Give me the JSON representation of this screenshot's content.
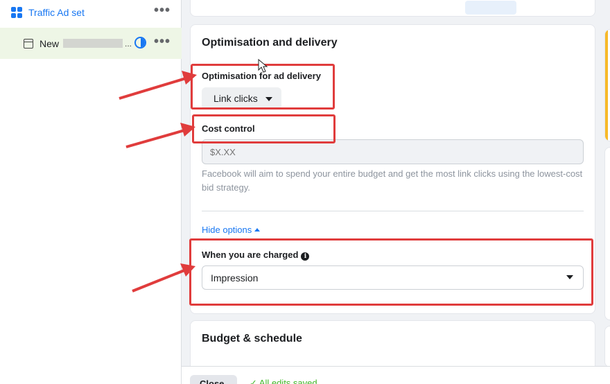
{
  "sidebar": {
    "adset_label": "Traffic Ad set",
    "ad_label": "New",
    "ad_suffix": "..."
  },
  "optimisation_card": {
    "title": "Optimisation and delivery",
    "optimisation_label": "Optimisation for ad delivery",
    "optimisation_value": "Link clicks",
    "cost_control_label": "Cost control",
    "cost_placeholder": "$X.XX",
    "helper_text": "Facebook will aim to spend your entire budget and get the most link clicks using the lowest-cost bid strategy.",
    "hide_options": "Hide options",
    "charged_label": "When you are charged",
    "charged_value": "Impression"
  },
  "budget_card": {
    "title": "Budget & schedule"
  },
  "bottom_bar": {
    "close_label": "Close",
    "saved_text": "✓ All edits saved"
  },
  "colors": {
    "accent": "#1877f2",
    "annotation_red": "#e03c3c",
    "warning_yellow": "#f7b928"
  }
}
